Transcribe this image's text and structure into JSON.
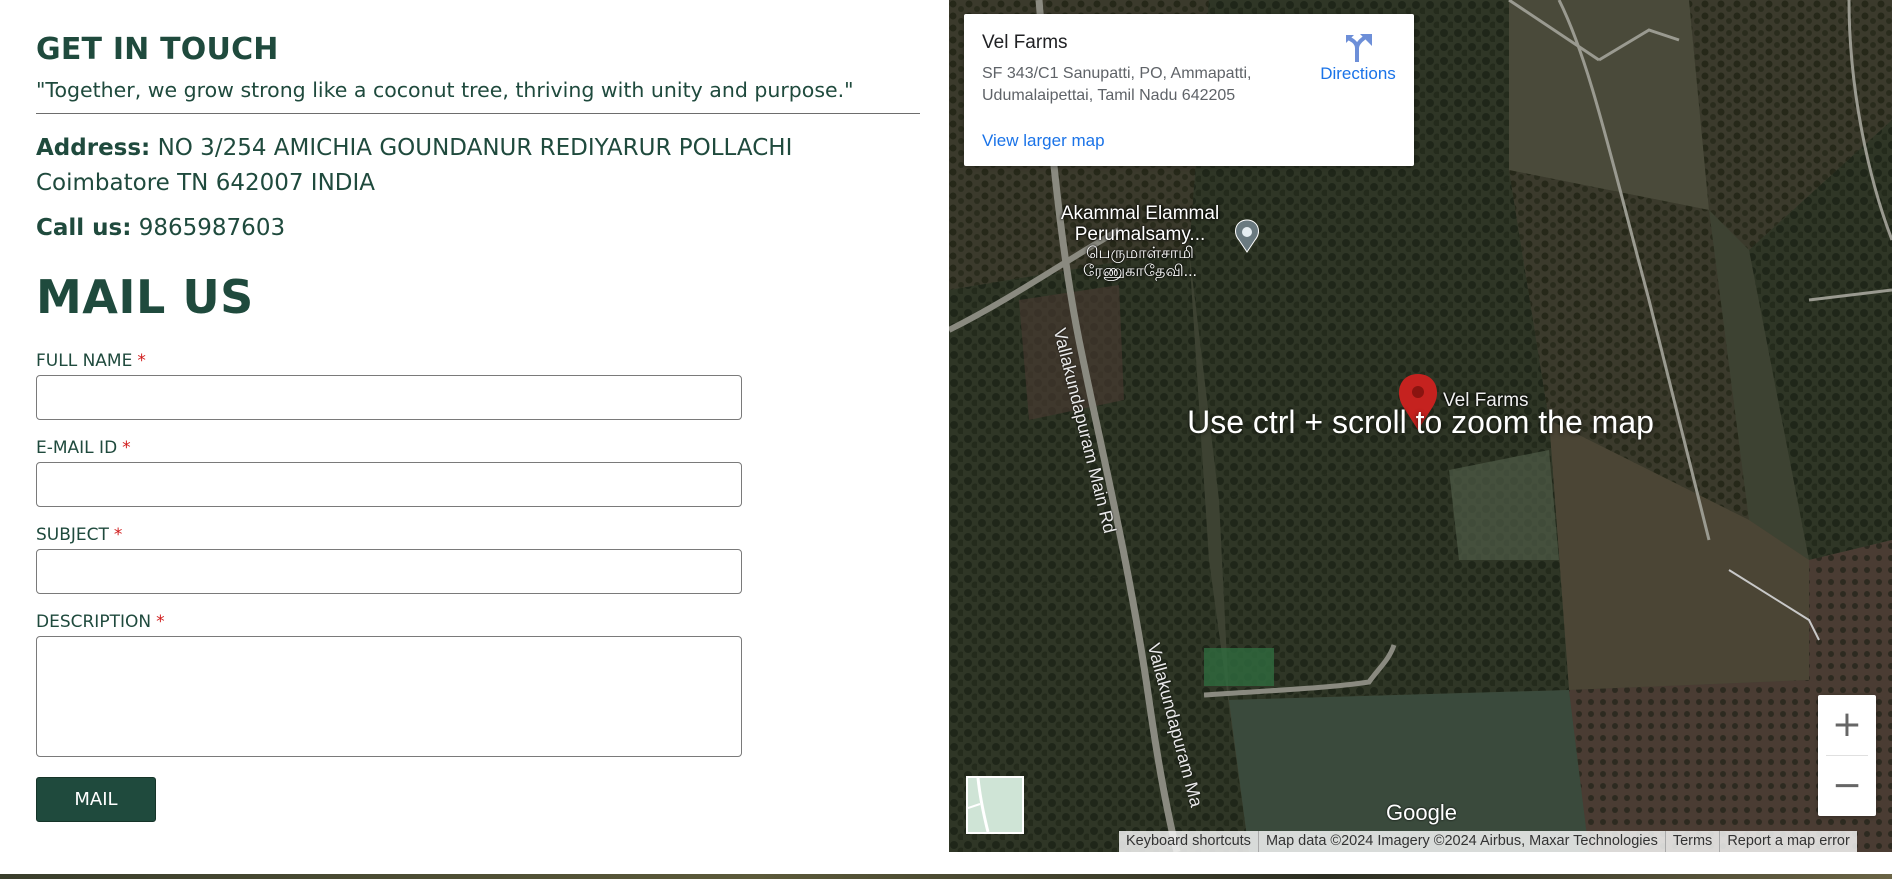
{
  "contact": {
    "heading": "GET IN TOUCH",
    "quote": "\"Together, we grow strong like a coconut tree, thriving with unity and purpose.\"",
    "address_label": "Address:",
    "address_line1": "NO 3/254 AMICHIA GOUNDANUR REDIYARUR POLLACHI",
    "address_line2": "Coimbatore TN 642007 INDIA",
    "phone_label": "Call us:",
    "phone_value": "9865987603"
  },
  "mail_form": {
    "heading": "MAIL US",
    "required_mark": "*",
    "full_name": {
      "label": "FULL NAME",
      "value": ""
    },
    "email": {
      "label": "E-MAIL ID",
      "value": ""
    },
    "subject": {
      "label": "SUBJECT",
      "value": ""
    },
    "description": {
      "label": "DESCRIPTION",
      "value": ""
    },
    "submit_label": "MAIL"
  },
  "map": {
    "place_name": "Vel Farms",
    "place_address": "SF 343/C1 Sanupatti, PO, Ammapatti, Udumalaipettai, Tamil Nadu 642205",
    "directions_label": "Directions",
    "larger_map_link": "View larger map",
    "temple_label_line1": "Akammal Elammal",
    "temple_label_line2": "Perumalsamy...",
    "temple_label_line3": "பெருமாள்சாமி",
    "temple_label_line4": "ரேணுகாதேவி...",
    "road_label_1": "Vallakundapuram Main Rd",
    "road_label_2": "Vallakundapuram Ma",
    "pin_label": "Vel Farms",
    "zoom_hint": "Use ctrl + scroll to zoom the map",
    "zoom_in_label": "+",
    "zoom_out_label": "−",
    "google_logo": "Google",
    "attribution": {
      "keyboard_shortcuts": "Keyboard shortcuts",
      "map_data": "Map data ©2024 Imagery ©2024 Airbus, Maxar Technologies",
      "terms": "Terms",
      "report_error": "Report a map error"
    },
    "icons": {
      "directions": "directions-icon",
      "pin": "map-pin-icon",
      "temple": "om-temple-icon"
    },
    "colors": {
      "accent_green": "#1f4a3d",
      "link_blue": "#1a73e8",
      "required_red": "#d01b1b",
      "pin_red": "#c5221f"
    }
  }
}
